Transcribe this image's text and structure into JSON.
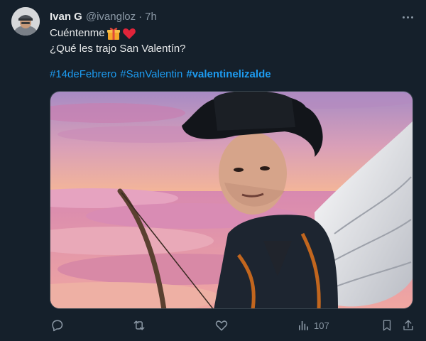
{
  "author": {
    "name": "Ivan G",
    "handle": "@ivangloz",
    "time": "7h",
    "avatar_icon": "avatar-man-cap-icon"
  },
  "tweet": {
    "line1": "Cuéntenme",
    "line1_emojis": [
      "gift-icon",
      "red-heart-icon"
    ],
    "line2": "¿Qué les trajo San Valentín?",
    "hashtags": [
      "#14deFebrero",
      "#SanValentin",
      "#valentinelizalde"
    ]
  },
  "media": {
    "description_icon": "photo-cowboy-with-wings-and-bow"
  },
  "actions": {
    "reply_icon": "reply-icon",
    "retweet_icon": "retweet-icon",
    "like_icon": "heart-outline-icon",
    "views_icon": "views-bar-icon",
    "views_count": "107",
    "bookmark_icon": "bookmark-icon",
    "share_icon": "share-icon"
  },
  "colors": {
    "background": "#15202b",
    "text_primary": "#e7e9ea",
    "text_secondary": "#8b98a5",
    "link": "#1d9bf0"
  }
}
